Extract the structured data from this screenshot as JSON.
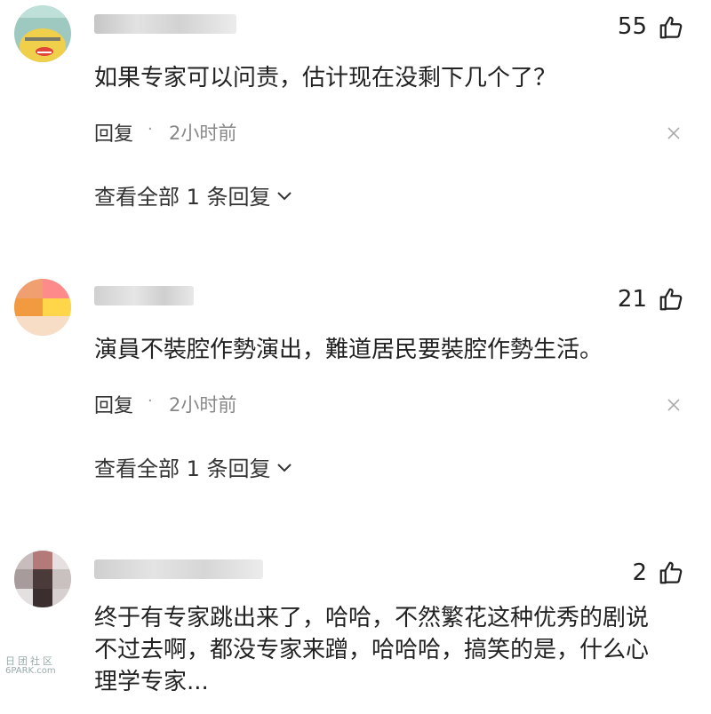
{
  "comments": [
    {
      "likes": "55",
      "text": "如果专家可以问责，估计现在没剩下几个了？",
      "reply_label": "回复",
      "separator": "·",
      "time": "2小时前",
      "view_replies": "查看全部 1 条回复"
    },
    {
      "likes": "21",
      "text": "演員不裝腔作勢演出，難道居民要裝腔作勢生活。",
      "reply_label": "回复",
      "separator": "·",
      "time": "2小时前",
      "view_replies": "查看全部 1 条回复"
    },
    {
      "likes": "2",
      "text_lines": [
        "终于有专家跳出来了，哈哈，不然繁花这种优秀的剧说",
        "不过去啊，都没专家来蹭，哈哈哈，搞笑的是，什么心",
        "理学专家..."
      ]
    }
  ],
  "watermark": {
    "line1": "日团社区",
    "line2": "6PARK.com"
  },
  "icons": {
    "like": "thumbs-up-icon",
    "close": "close-icon",
    "expand": "chevron-down-icon"
  },
  "colors": {
    "text": "#222222",
    "secondary": "#888888",
    "background": "#ffffff"
  }
}
